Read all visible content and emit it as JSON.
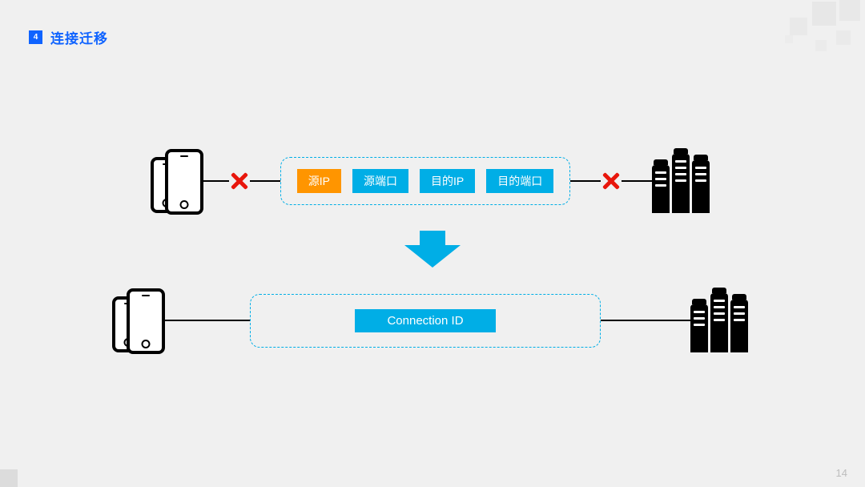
{
  "header": {
    "index": "4",
    "title": "连接迁移"
  },
  "row1": {
    "chips": {
      "src_ip": "源IP",
      "src_port": "源端口",
      "dst_ip": "目的IP",
      "dst_port": "目的端口"
    }
  },
  "row2": {
    "chip": "Connection ID"
  },
  "page_number": "14"
}
